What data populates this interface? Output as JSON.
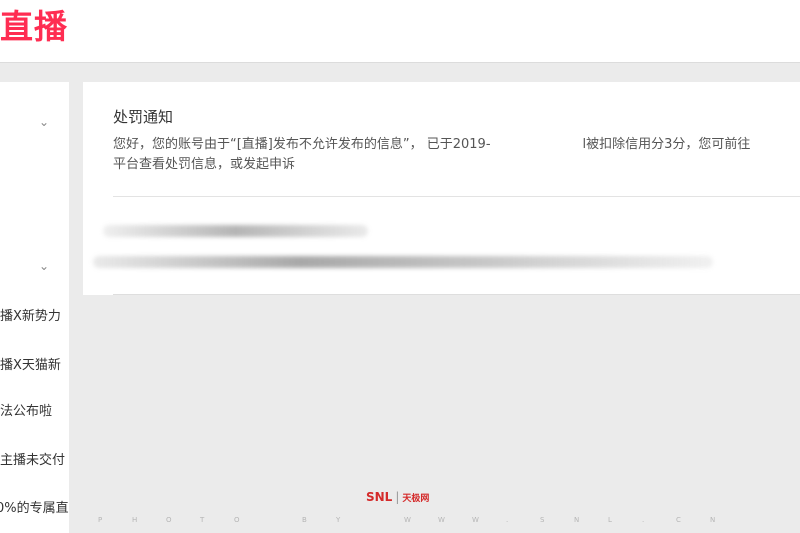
{
  "header": {
    "logo_text": "直播",
    "brand_color": "#ff2d52"
  },
  "sidebar": {
    "chevron_glyph": "⌄",
    "items": [
      {
        "label": "直播X新势力"
      },
      {
        "label": "直播X天猫新"
      },
      {
        "label": "法公布啦"
      },
      {
        "label": "主播未交付"
      },
      {
        "label": "0%的专属直"
      }
    ]
  },
  "notice": {
    "title": "处罚通知",
    "body_line1_part1": "您好，您的账号由于“[直播]发布不允许发布的信息”， 已于2019-",
    "body_line1_part2": "l被扣除信用分3分，您可前往",
    "body_line2": "平台查看处罚信息，或发起申诉"
  },
  "watermark": {
    "brand": "SNL",
    "brand_cn": "天极网",
    "sub_chars": [
      "P",
      "H",
      "O",
      "T",
      "O",
      "",
      "B",
      "Y",
      "",
      "W",
      "W",
      "W",
      ".",
      "S",
      "N",
      "L",
      ".",
      "C",
      "N"
    ]
  }
}
